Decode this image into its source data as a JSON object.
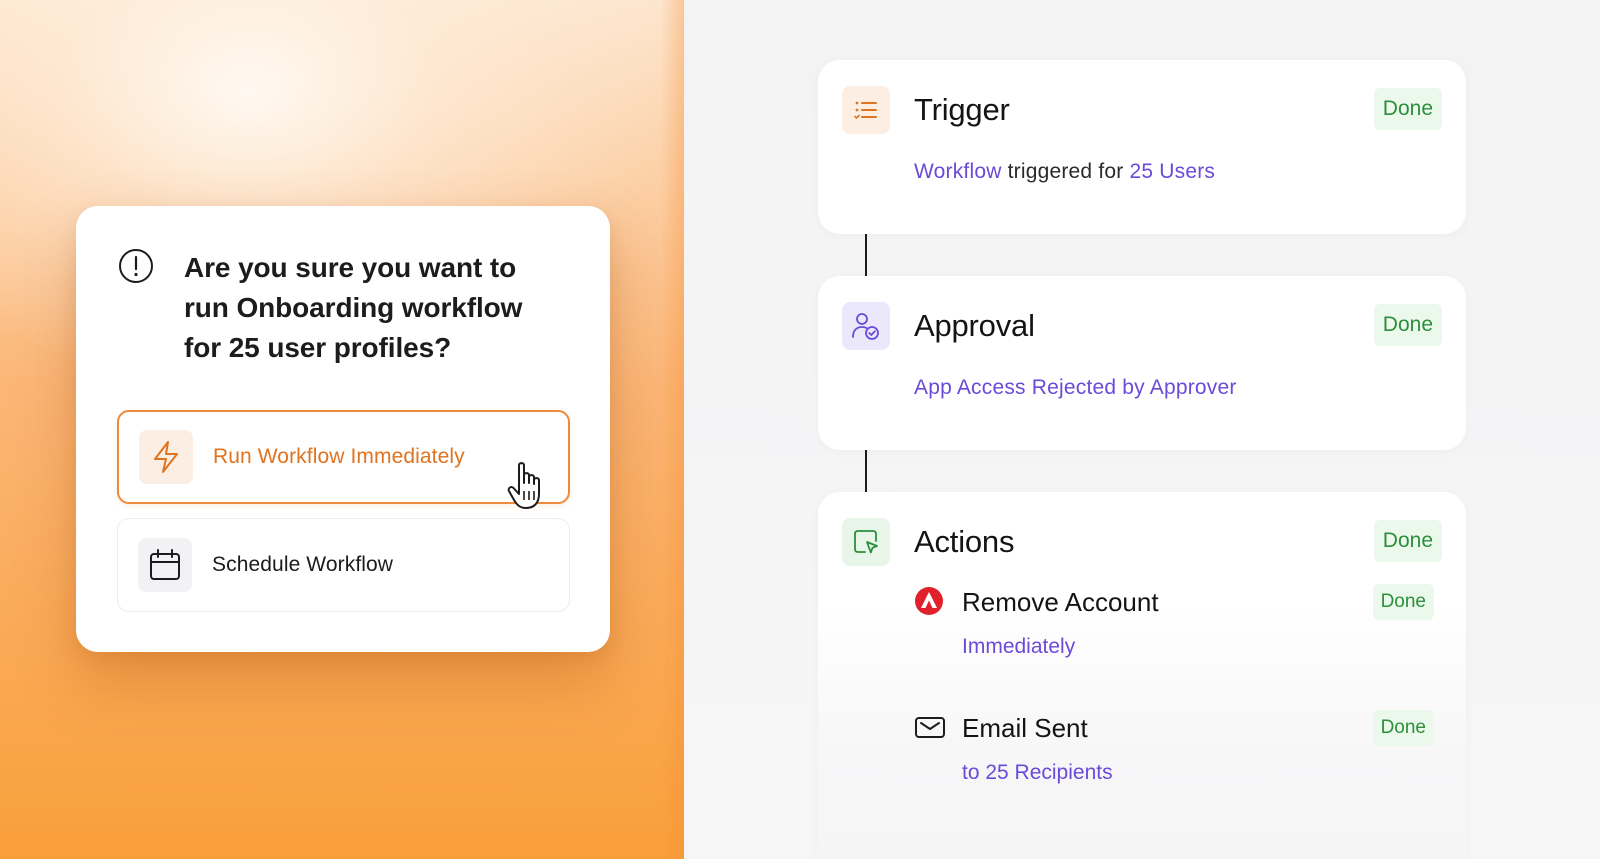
{
  "dialog": {
    "title": "Are you sure you want to run Onboarding workflow for 25 user profiles?",
    "icon": "alert-circle-icon",
    "options": [
      {
        "label": "Run Workflow Immediately",
        "icon": "lightning-bolt-icon",
        "selected": true
      },
      {
        "label": "Schedule Workflow",
        "icon": "calendar-icon",
        "selected": false
      }
    ]
  },
  "workflow": {
    "trigger": {
      "title": "Trigger",
      "status": "Done",
      "icon": "list-icon",
      "subtitle_part1": "Workflow",
      "subtitle_part2": " triggered for ",
      "subtitle_part3": "25 Users"
    },
    "approval": {
      "title": "Approval",
      "status": "Done",
      "icon": "user-check-icon",
      "subtitle": "App Access Rejected by Approver"
    },
    "actions": {
      "title": "Actions",
      "status": "Done",
      "icon": "window-cursor-icon",
      "items": [
        {
          "title": "Remove Account",
          "desc": "Immediately",
          "status": "Done",
          "icon": "app-logo-icon"
        },
        {
          "title": "Email Sent",
          "desc": "to 25 Recipients",
          "status": "Done",
          "icon": "envelope-icon"
        }
      ]
    }
  },
  "colors": {
    "accent_orange": "#e0731f",
    "accent_purple": "#6a4bd8",
    "done_green": "#2c8f3c",
    "done_bg": "#ebf8ec"
  }
}
